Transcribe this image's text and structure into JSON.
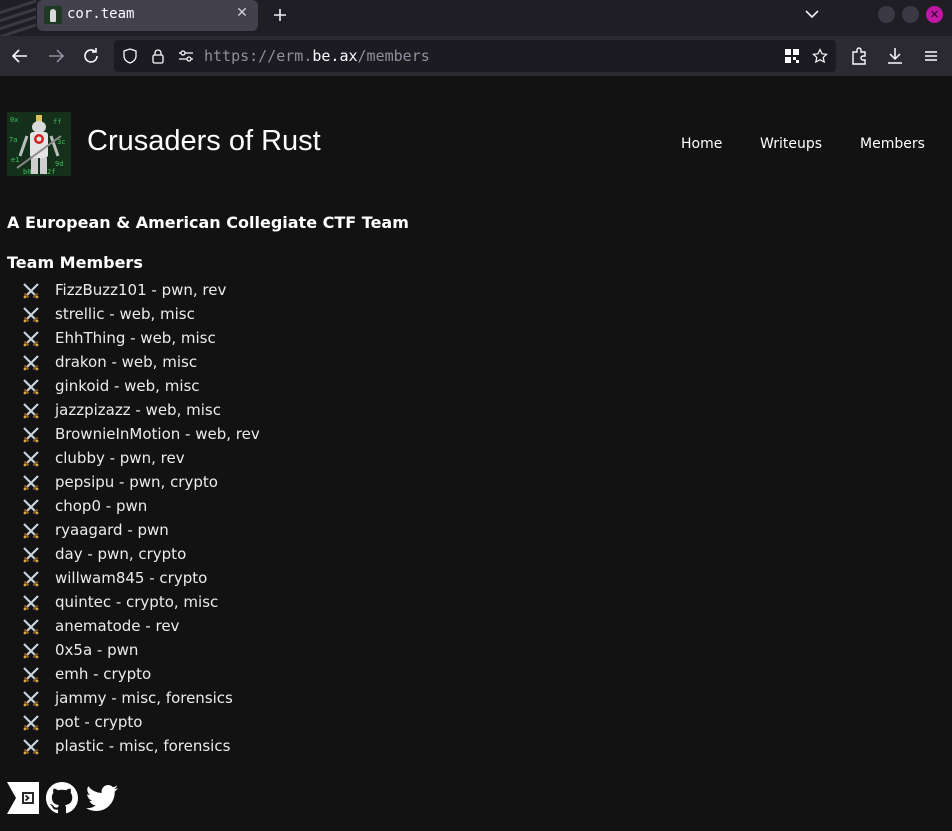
{
  "browser": {
    "tab_title": "cor.team",
    "url_prefix": "https://erm.",
    "url_domain": "be.ax",
    "url_path": "/members",
    "icons": {
      "tab_close": "close-icon",
      "new_tab": "plus-icon",
      "back": "back-arrow-icon",
      "forward": "forward-arrow-icon",
      "reload": "reload-icon",
      "shield": "shield-icon",
      "lock": "lock-icon",
      "permissions": "sliders-icon",
      "qr": "qr-code-icon",
      "bookmark": "star-icon",
      "extensions": "puzzle-icon",
      "downloads": "download-icon",
      "menu": "hamburger-icon"
    }
  },
  "site": {
    "title": "Crusaders of Rust",
    "nav": [
      "Home",
      "Writeups",
      "Members"
    ],
    "tagline": "A European & American Collegiate CTF Team",
    "members_heading": "Team Members",
    "members": [
      "FizzBuzz101 - pwn, rev",
      "strellic - web, misc",
      "EhhThing - web, misc",
      "drakon - web, misc",
      "ginkoid - web, misc",
      "jazzpizazz - web, misc",
      "BrownieInMotion - web, rev",
      "clubby - pwn, rev",
      "pepsipu - pwn, crypto",
      "chop0 - pwn",
      "ryaagard - pwn",
      "day - pwn, crypto",
      "willwam845 - crypto",
      "quintec - crypto, misc",
      "anematode - rev",
      "0x5a - pwn",
      "emh - crypto",
      "jammy - misc, forensics",
      "pot - crypto",
      "plastic - misc, forensics"
    ],
    "bullet_icon": "crossed-swords-icon",
    "social_icons": [
      "ctftime-icon",
      "github-icon",
      "twitter-icon"
    ]
  },
  "colors": {
    "page_bg": "#121212",
    "tab_active_bg": "#42414d",
    "toolbar_bg": "#2b2a33",
    "urlbar_bg": "#1c1b22",
    "close_accent": "#c018a4"
  }
}
